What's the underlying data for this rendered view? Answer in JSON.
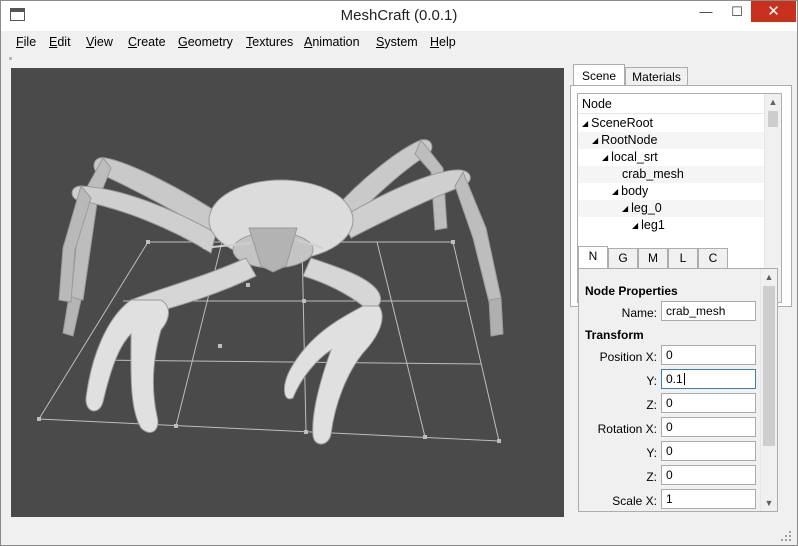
{
  "window": {
    "title": "MeshCraft (0.0.1)",
    "min_glyph": "—",
    "max_glyph": "☐",
    "close_glyph": "✕"
  },
  "menu": [
    "File",
    "Edit",
    "View",
    "Create",
    "Geometry",
    "Textures",
    "Animation",
    "System",
    "Help"
  ],
  "viewport": {
    "background": "#4a4a4a",
    "model_color": "#d9d9d9",
    "grid_color": "#bdbdbd"
  },
  "panel": {
    "tabs": [
      "Scene",
      "Materials"
    ],
    "active_tab": "Scene",
    "tree": {
      "header": "Node",
      "rows": [
        {
          "label": "SceneRoot",
          "expanded": true
        },
        {
          "label": "RootNode",
          "expanded": true
        },
        {
          "label": "local_srt",
          "expanded": true
        },
        {
          "label": "crab_mesh",
          "expanded": null
        },
        {
          "label": "body",
          "expanded": true
        },
        {
          "label": "leg_0",
          "expanded": true
        },
        {
          "label": "leg1",
          "expanded": true
        }
      ]
    },
    "subtabs": [
      "N",
      "G",
      "M",
      "L",
      "C"
    ],
    "active_subtab": "N",
    "properties": {
      "section_node": "Node Properties",
      "name_label": "Name:",
      "name_value": "crab_mesh",
      "section_transform": "Transform",
      "position_x_label": "Position X:",
      "position_x": "0",
      "position_y_label": "Y:",
      "position_y": "0.1",
      "position_z_label": "Z:",
      "position_z": "0",
      "rotation_x_label": "Rotation X:",
      "rotation_x": "0",
      "rotation_y_label": "Y:",
      "rotation_y": "0",
      "rotation_z_label": "Z:",
      "rotation_z": "0",
      "scale_x_label": "Scale X:",
      "scale_x": "1"
    }
  },
  "icons": {
    "tree_expanded": "◢",
    "scroll_up": "▲",
    "scroll_down": "▼"
  }
}
